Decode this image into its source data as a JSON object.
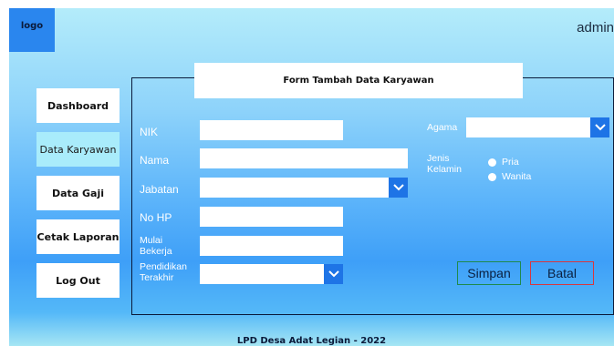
{
  "header": {
    "logo": "logo",
    "user": "admin"
  },
  "sidebar": {
    "items": [
      {
        "label": "Dashboard"
      },
      {
        "label": "Data Karyawan",
        "active": true
      },
      {
        "label": "Data Gaji"
      },
      {
        "label": "Cetak Laporan"
      },
      {
        "label": "Log Out"
      }
    ]
  },
  "form": {
    "title": "Form Tambah Data Karyawan",
    "labels": {
      "nik": "NIK",
      "nama": "Nama",
      "jabatan": "Jabatan",
      "nohp": "No HP",
      "mulai_l1": "Mulai",
      "mulai_l2": "Bekerja",
      "pendidikan_l1": "Pendidikan",
      "pendidikan_l2": "Terakhir",
      "agama": "Agama",
      "jk_l1": "Jenis",
      "jk_l2": "Kelamin"
    },
    "values": {
      "nik": "",
      "nama": "",
      "jabatan": "",
      "nohp": "",
      "mulai": "",
      "pendidikan": "",
      "agama": ""
    },
    "radio": {
      "pria": "Pria",
      "wanita": "Wanita"
    },
    "buttons": {
      "save": "Simpan",
      "cancel": "Batal"
    }
  },
  "footer": "LPD Desa Adat Legian - 2022",
  "colors": {
    "accent": "#1e74e6",
    "save_border": "#1f8a4c",
    "cancel_border": "#d9363e"
  },
  "icons": {
    "dropdown": "chevron-down-icon"
  }
}
